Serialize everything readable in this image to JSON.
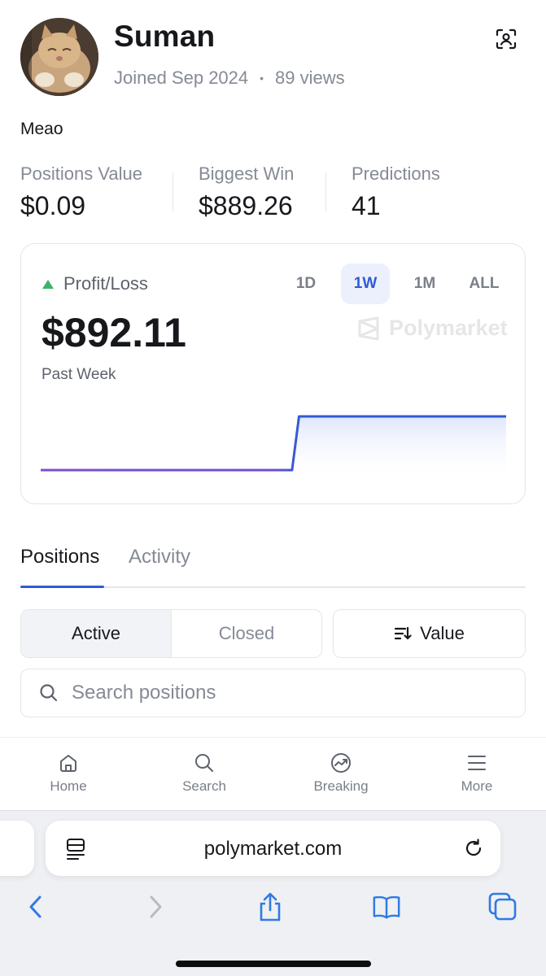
{
  "profile": {
    "name": "Suman",
    "joined": "Joined Sep 2024",
    "dot": "•",
    "views": "89 views",
    "bio": "Meao",
    "avatar_icon": "cat-avatar"
  },
  "stats": [
    {
      "label": "Positions Value",
      "value": "$0.09"
    },
    {
      "label": "Biggest Win",
      "value": "$889.26"
    },
    {
      "label": "Predictions",
      "value": "41"
    }
  ],
  "pl_card": {
    "title": "Profit/Loss",
    "ranges": [
      "1D",
      "1W",
      "1M",
      "ALL"
    ],
    "active_range": "1W",
    "value": "$892.11",
    "period": "Past Week",
    "watermark": "Polymarket",
    "trend_color": "#3db36b"
  },
  "chart_data": {
    "type": "area",
    "title": "",
    "xlabel": "",
    "ylabel": "",
    "x": [
      0,
      0.54,
      0.555,
      1.0
    ],
    "y": [
      0,
      0,
      892.11,
      892.11
    ],
    "ylim": [
      0,
      892.11
    ],
    "grid": false,
    "colors": {
      "line_start": "#7b4fc9",
      "line_end": "#2f5bd4",
      "fill": "#dfe6fb"
    }
  },
  "tabs": [
    {
      "label": "Positions",
      "active": true
    },
    {
      "label": "Activity",
      "active": false
    }
  ],
  "filters": {
    "segments": [
      {
        "label": "Active",
        "active": true
      },
      {
        "label": "Closed",
        "active": false
      }
    ],
    "sort_label": "Value"
  },
  "search": {
    "placeholder": "Search positions",
    "value": ""
  },
  "bottom_nav": [
    {
      "label": "Home",
      "icon": "home-icon"
    },
    {
      "label": "Search",
      "icon": "search-icon"
    },
    {
      "label": "Breaking",
      "icon": "trending-icon"
    },
    {
      "label": "More",
      "icon": "menu-icon"
    }
  ],
  "browser": {
    "url": "polymarket.com"
  },
  "colors": {
    "accent": "#2f5bd4",
    "accent_bg": "#ecf0fd",
    "muted": "#858a94",
    "border": "#e4e6ea"
  }
}
